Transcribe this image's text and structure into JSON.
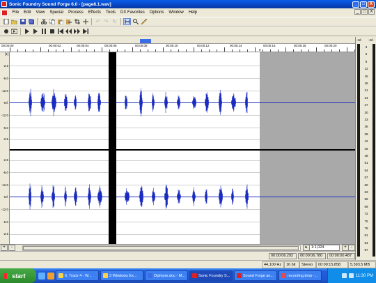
{
  "app": {
    "title": "Sonic Foundry Sound Forge 6.0 - [page8.1.wav]",
    "window_buttons": [
      "_",
      "□",
      "X"
    ]
  },
  "menu": [
    "File",
    "Edit",
    "View",
    "Special",
    "Process",
    "Effects",
    "Tools",
    "DX Favorites",
    "Options",
    "Window",
    "Help"
  ],
  "toolbar1_icons": [
    "new-icon",
    "open-icon",
    "save-icon",
    "save-all-icon",
    "cut-icon",
    "copy-icon",
    "paste-icon",
    "mix-icon",
    "crop-icon",
    "trim-icon",
    "undo-icon",
    "redo-icon",
    "repeat-icon",
    "edit-tool-icon",
    "magnify-tool-icon",
    "pencil-tool-icon"
  ],
  "toolbar2_icons": [
    "record-icon",
    "loop-icon",
    "play-all-icon",
    "play-icon",
    "pause-icon",
    "stop-icon",
    "rewind-start-icon",
    "rewind-icon",
    "forward-icon",
    "forward-end-icon"
  ],
  "ruler": {
    "labels": [
      "00:00:00",
      "00:00:02",
      "00:00:04",
      "00:00:06",
      "00:00:08",
      "00:00:10",
      "00:00:12",
      "00:00:14",
      "00:00:16",
      "00:00:18",
      "00:00:20"
    ],
    "marker": "0"
  },
  "channel_scale": [
    "-2.5",
    "-6.0",
    "-12.0",
    "-Inf.",
    "-12.0",
    "-6.0",
    "-2.5"
  ],
  "channel_index": "[1]",
  "meter": {
    "header_left": "-Inf.",
    "header_right": "-Inf.",
    "scale": [
      "3",
      "6",
      "9",
      "12",
      "15",
      "18",
      "21",
      "24",
      "27",
      "30",
      "33",
      "36",
      "39",
      "42",
      "45",
      "48",
      "51",
      "54",
      "57",
      "60",
      "63",
      "66",
      "69",
      "72",
      "75",
      "78",
      "81",
      "84",
      "87"
    ]
  },
  "zoom": {
    "ratio": "1:1,024",
    "plus": "+",
    "minus": "-"
  },
  "selection": {
    "start": "00:00:06.292",
    "end": "00:00:06.780",
    "length": "00:00:00.487"
  },
  "status": {
    "sample_rate": "44,100 Hz",
    "bit_depth": "16 bit",
    "channels": "Stereo",
    "duration": "00:00:15.858",
    "free_space": "5,593.5 MB"
  },
  "taskbar": {
    "start": "start",
    "tasks": [
      "6. Track 4 - W...",
      "3 Windows Ex...",
      "Diphone.doc - M...",
      "Sonic Foundry S...",
      "Sound Forge an...",
      "recording.bmp -..."
    ],
    "active_index": 3,
    "clock": "11:30 PM"
  },
  "colors": {
    "waveform": "#1a2bbf",
    "selection": "#000000",
    "unused_area": "#a9a9a9",
    "titlebar": "#0846c4"
  }
}
